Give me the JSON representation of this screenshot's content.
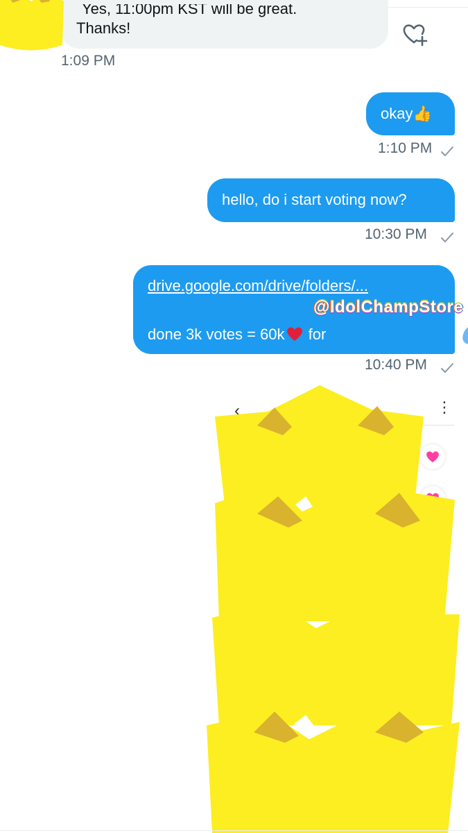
{
  "received": {
    "cut_text": "Yes, 11:00pm KST will be great.",
    "text": "Thanks!",
    "time": "1:09 PM"
  },
  "sent": [
    {
      "text": "okay👍",
      "time": "1:10 PM"
    },
    {
      "text": "hello, do i start voting now?",
      "time": "10:30 PM"
    },
    {
      "link": "drive.google.com/drive/folders/...",
      "watermark": "@IdolChampStore",
      "line3_start": "done 3k votes = 60k",
      "line3_end": "for",
      "time": "10:40 PM"
    }
  ],
  "image_preview": {
    "title_fragment": "e"
  },
  "colors": {
    "bubble_out": "#1d9bf0",
    "bubble_in": "#eff3f4",
    "timestamp": "#536471",
    "crown": "#fcee21",
    "crown_shadow": "#d9b22e"
  },
  "icons": {
    "react": "heart-plus-icon",
    "read": "checkmark-icon",
    "back": "chevron-left-icon",
    "more": "more-vertical-icon"
  }
}
